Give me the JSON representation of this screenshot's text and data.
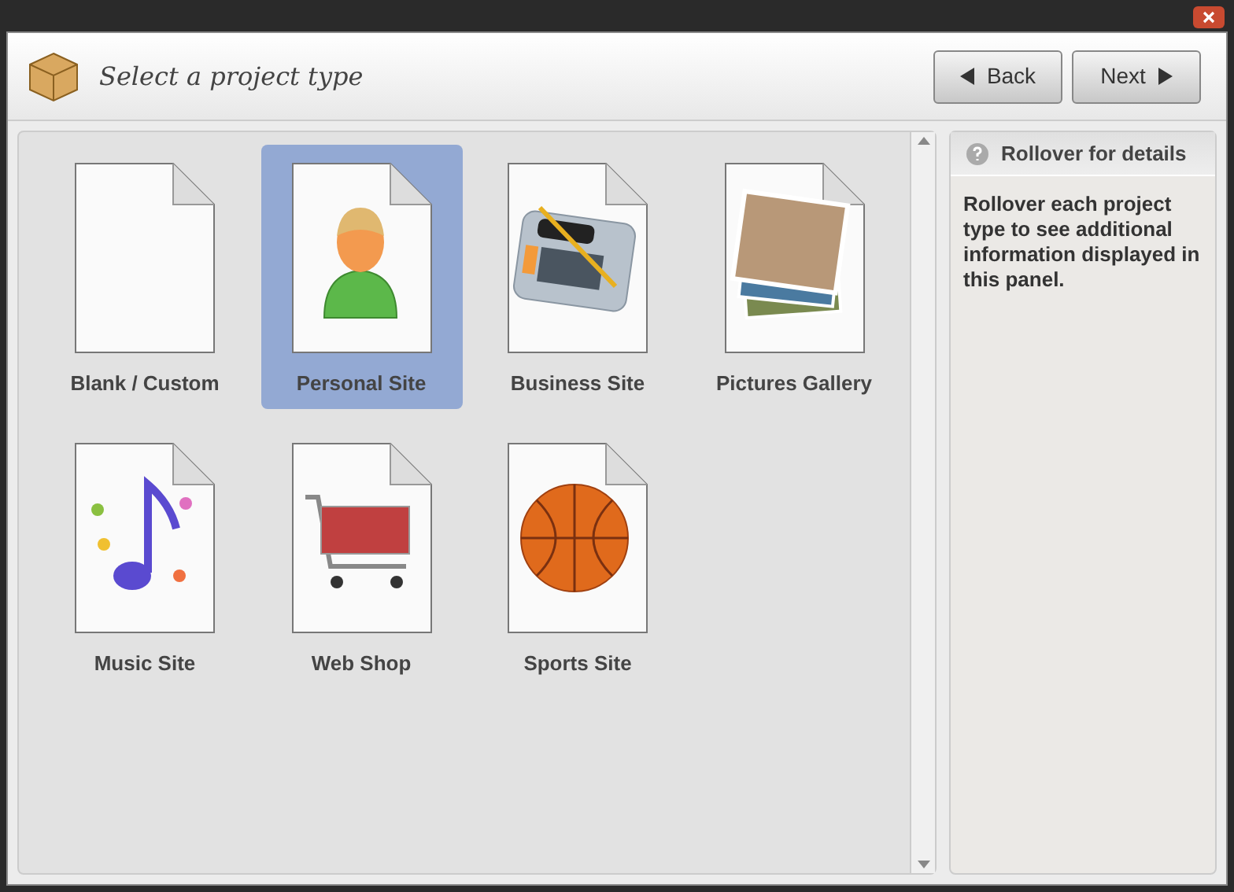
{
  "header": {
    "title": "Select a project type",
    "buttons": [
      {
        "label": "Back",
        "kind": "back"
      },
      {
        "label": "Next",
        "kind": "next"
      }
    ]
  },
  "project_types": [
    {
      "label": "Blank / Custom",
      "kind": "blank",
      "selected": false
    },
    {
      "label": "Personal Site",
      "kind": "person",
      "selected": true
    },
    {
      "label": "Business Site",
      "kind": "calculator",
      "selected": false
    },
    {
      "label": "Pictures Gallery",
      "kind": "photos",
      "selected": false
    },
    {
      "label": "Music Site",
      "kind": "music",
      "selected": false
    },
    {
      "label": "Web Shop",
      "kind": "cart",
      "selected": false
    },
    {
      "label": "Sports Site",
      "kind": "ball",
      "selected": false
    }
  ],
  "details_panel": {
    "title": "Rollover for details",
    "text": "Rollover each project type to see additional information displayed in this panel."
  }
}
